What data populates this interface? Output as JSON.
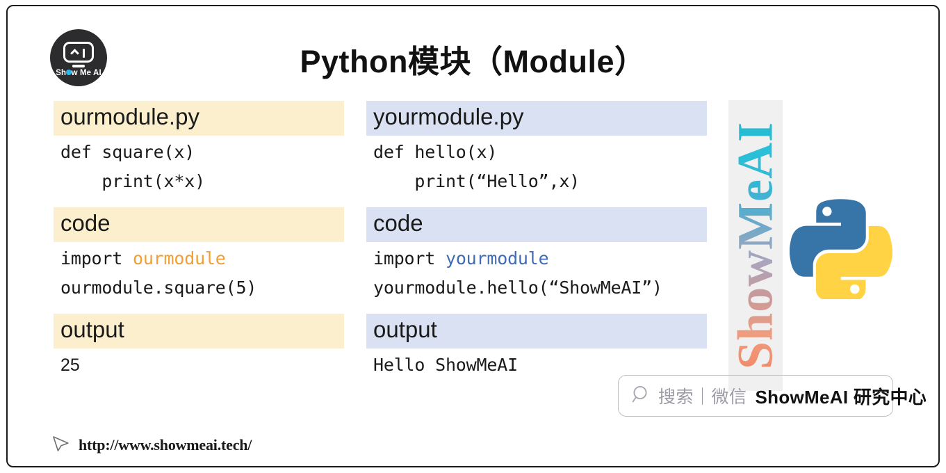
{
  "slide": {
    "title": "Python模块（Module）"
  },
  "logo": {
    "name": "show-me-ai-logo",
    "text_before": "Sh",
    "text_after": "w Me AI",
    "circle_color": "#2c2c2e",
    "dot_color": "#29b6e8"
  },
  "left_column": {
    "blocks": [
      {
        "header": "ourmodule.py",
        "band_color": "#fcefcd",
        "lines": [
          {
            "text": "def square(x)",
            "style": "mono"
          },
          {
            "text": "    print(x*x)",
            "style": "mono"
          }
        ]
      },
      {
        "header": "code",
        "band_color": "#fcefcd",
        "lines": [
          {
            "prefix": "import ",
            "highlight": "ourmodule",
            "suffix": "",
            "style": "mono",
            "highlight_color": "#f2a034"
          },
          {
            "text": "ourmodule.square(5)",
            "style": "mono"
          }
        ]
      },
      {
        "header": "output",
        "band_color": "#fcefcd",
        "lines": [
          {
            "text": "25",
            "style": "sans"
          }
        ]
      }
    ]
  },
  "right_column": {
    "blocks": [
      {
        "header": "yourmodule.py",
        "band_color": "#d9e1f2",
        "lines": [
          {
            "text": "def hello(x)",
            "style": "mono"
          },
          {
            "text": "    print(“Hello”,x)",
            "style": "mono"
          }
        ]
      },
      {
        "header": "code",
        "band_color": "#d9e1f2",
        "lines": [
          {
            "prefix": "import ",
            "highlight": "yourmodule",
            "suffix": "",
            "style": "mono",
            "highlight_color": "#3f6cb4"
          },
          {
            "text": "yourmodule.hello(“ShowMeAI”)",
            "style": "mono"
          }
        ]
      },
      {
        "header": "output",
        "band_color": "#d9e1f2",
        "lines": [
          {
            "text": "Hello ShowMeAI",
            "style": "mono"
          }
        ]
      }
    ]
  },
  "vertical_banner": {
    "text": "ShowMeAI",
    "background": "#f0f0f0"
  },
  "python_logo": {
    "name": "python-logo",
    "blue": "#3775a9",
    "yellow": "#ffd343"
  },
  "badge": {
    "search_icon": "magnifier-icon",
    "gray_text": "搜索｜微信",
    "bold_text": "ShowMeAI 研究中心",
    "gray_color": "#9b9ba3"
  },
  "footer": {
    "cursor_icon": "cursor-arrow-icon",
    "url": "http://www.showmeai.tech/"
  }
}
